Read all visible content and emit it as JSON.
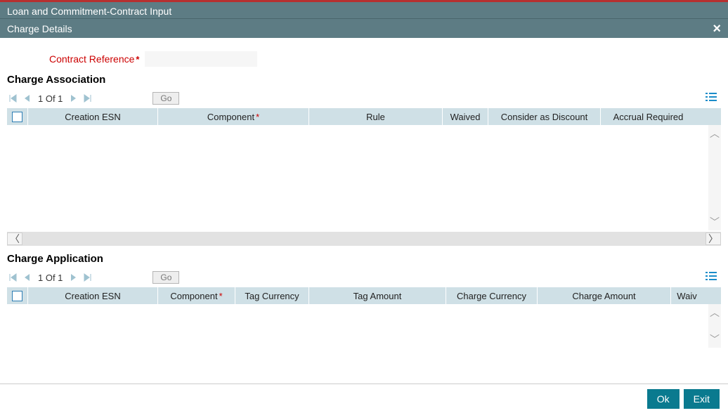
{
  "window": {
    "title": "Loan and Commitment-Contract Input",
    "subtitle": "Charge Details"
  },
  "form": {
    "contract_reference_label": "Contract Reference",
    "contract_reference_value": ""
  },
  "sections": {
    "association": {
      "title": "Charge Association",
      "pager": "1 Of 1",
      "go_label": "Go",
      "columns": {
        "creation_esn": "Creation ESN",
        "component": "Component",
        "rule": "Rule",
        "waived": "Waived",
        "consider_discount": "Consider as Discount",
        "accrual_required": "Accrual Required"
      }
    },
    "application": {
      "title": "Charge Application",
      "pager": "1 Of 1",
      "go_label": "Go",
      "columns": {
        "creation_esn": "Creation ESN",
        "component": "Component",
        "tag_currency": "Tag Currency",
        "tag_amount": "Tag Amount",
        "charge_currency": "Charge Currency",
        "charge_amount": "Charge Amount",
        "waived": "Waiv"
      }
    }
  },
  "footer": {
    "ok": "Ok",
    "exit": "Exit"
  }
}
